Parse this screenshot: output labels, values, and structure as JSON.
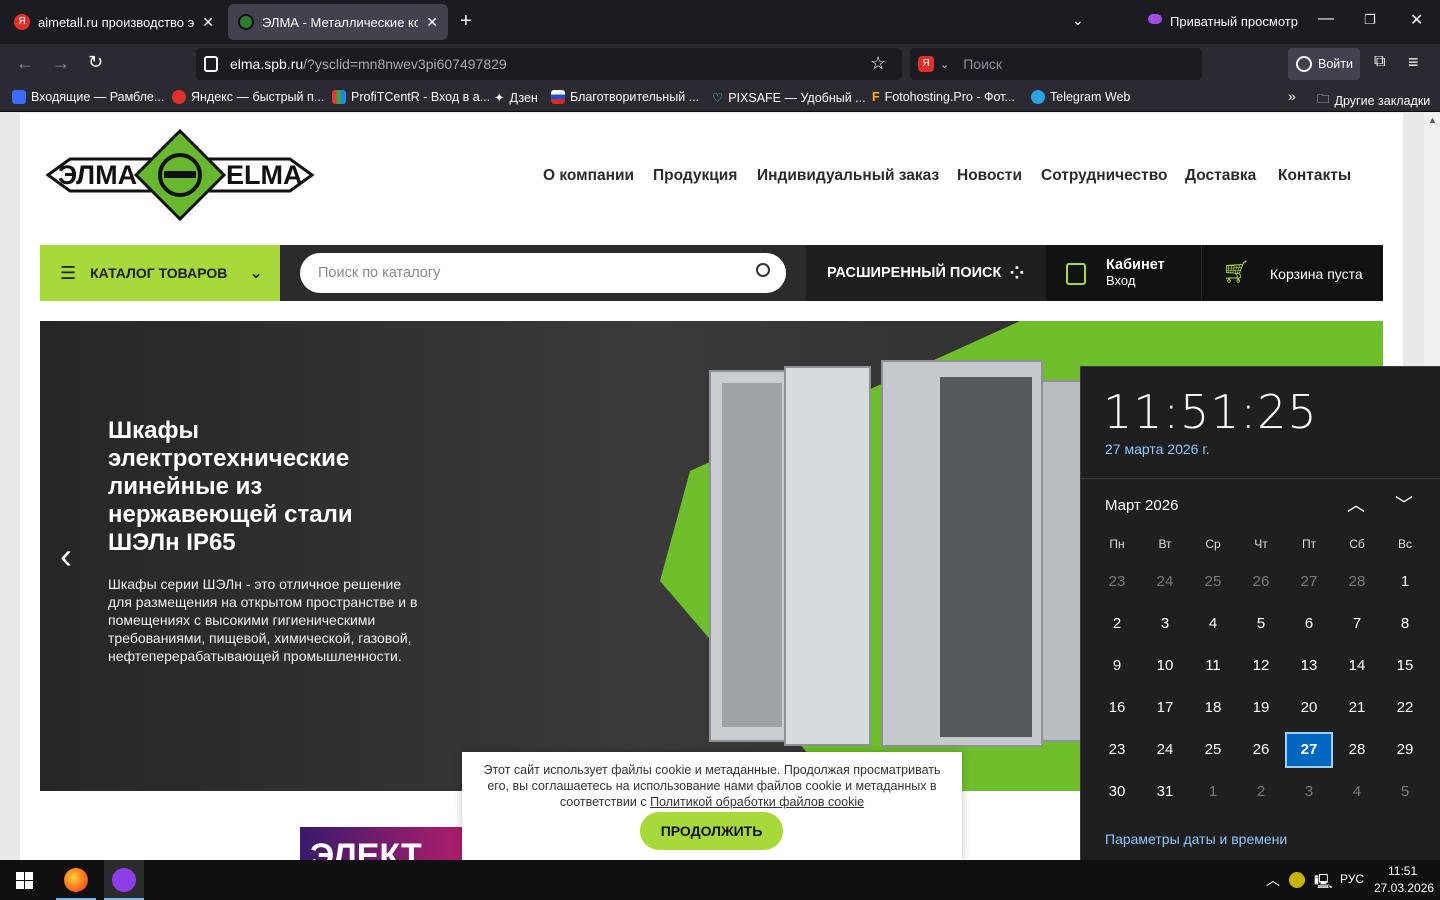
{
  "browser": {
    "tabs": [
      {
        "title": "aimetall.ru производство элект",
        "active": false
      },
      {
        "title": "ЭЛМА - Металлические корпу",
        "active": true
      }
    ],
    "private_label": "Приватный просмотр",
    "url_host": "elma.spb.ru",
    "url_rest": "/?ysclid=mn8nwev3pi607497829",
    "search_placeholder": "Поиск",
    "signin_label": "Войти",
    "bookmarks": [
      {
        "label": "Входящие — Рамбле..."
      },
      {
        "label": "Яндекс — быстрый п..."
      },
      {
        "label": "ProfiTCentR - Вход в а..."
      },
      {
        "label": "Дзен"
      },
      {
        "label": "Благотворительный ..."
      },
      {
        "label": "PIXSAFE — Удобный ..."
      },
      {
        "label": "Fotohosting.Pro - Фот..."
      },
      {
        "label": "Telegram Web"
      }
    ],
    "other_bookmarks": "Другие закладки"
  },
  "site": {
    "logo_left": "ЭЛМА",
    "logo_right": "ELMA",
    "nav": [
      "О компании",
      "Продукция",
      "Индивидуальный заказ",
      "Новости",
      "Сотрудничество",
      "Доставка",
      "Контакты"
    ],
    "catalog_label": "КАТАЛОГ ТОВАРОВ",
    "catalog_search_placeholder": "Поиск по каталогу",
    "advanced_search": "РАСШИРЕННЫЙ ПОИСК",
    "cabinet_title": "Кабинет",
    "cabinet_sub": "Вход",
    "cart_label": "Корзина пуста",
    "hero_title": "Шкафы электротехнические линейные из нержавеющей стали ШЭЛн IP65",
    "hero_text": "Шкафы серии ШЭЛн - это отличное решение для размещения на открытом пространстве и в помещениях с высокими гигиеническими требованиями, пищевой, химической, газовой, нефтеперерабатывающей промышленности.",
    "cookie_text": "Этот сайт использует файлы cookie и метаданные. Продолжая просматривать его, вы соглашаетесь на использование нами файлов cookie и метаданных в соответствии с",
    "cookie_link": "Политикой обработки файлов cookie",
    "cookie_button": "ПРОДОЛЖИТЬ",
    "banner_text": "ЭЛЕКТ"
  },
  "calendar": {
    "time": "11:51:25",
    "date_full": "27 марта 2026 г.",
    "month_label": "Март 2026",
    "weekdays": [
      "Пн",
      "Вт",
      "Ср",
      "Чт",
      "Пт",
      "Сб",
      "Вс"
    ],
    "weeks": [
      [
        "23",
        "24",
        "25",
        "26",
        "27",
        "28",
        "1"
      ],
      [
        "2",
        "3",
        "4",
        "5",
        "6",
        "7",
        "8"
      ],
      [
        "9",
        "10",
        "11",
        "12",
        "13",
        "14",
        "15"
      ],
      [
        "16",
        "17",
        "18",
        "19",
        "20",
        "21",
        "22"
      ],
      [
        "23",
        "24",
        "25",
        "26",
        "27",
        "28",
        "29"
      ],
      [
        "30",
        "31",
        "1",
        "2",
        "3",
        "4",
        "5"
      ]
    ],
    "today": "27",
    "settings_link": "Параметры даты и времени"
  },
  "taskbar": {
    "lang": "РУС",
    "time": "11:51",
    "date": "27.03.2026"
  },
  "colors": {
    "brand_green": "#a7d93a",
    "accent_blue": "#0067c0"
  }
}
